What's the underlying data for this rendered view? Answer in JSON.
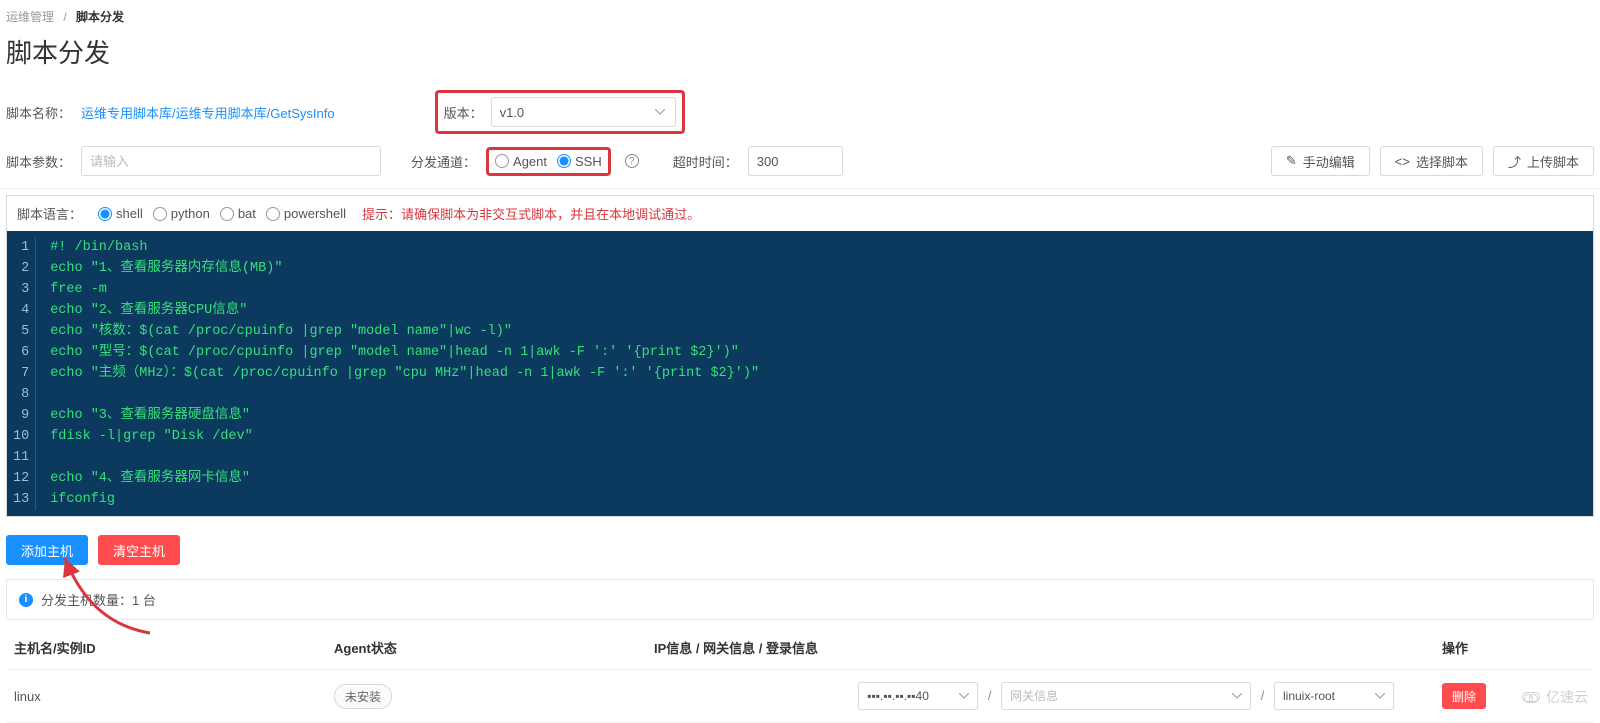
{
  "breadcrumb": {
    "parent": "运维管理",
    "current": "脚本分发"
  },
  "page_title": "脚本分发",
  "form": {
    "script_name_label": "脚本名称：",
    "script_name_value": "运维专用脚本库/运维专用脚本库/GetSysInfo",
    "version_label": "版本：",
    "version_value": "v1.0",
    "params_label": "脚本参数：",
    "params_placeholder": "请输入",
    "channel_label": "分发通道：",
    "channel_options": {
      "agent": "Agent",
      "ssh": "SSH"
    },
    "channel_selected": "ssh",
    "timeout_label": "超时时间：",
    "timeout_value": "300"
  },
  "toolbar": {
    "manual_edit": "手动编辑",
    "choose_script": "选择脚本",
    "upload_script": "上传脚本"
  },
  "editor": {
    "lang_label": "脚本语言：",
    "langs": {
      "shell": "shell",
      "python": "python",
      "bat": "bat",
      "powershell": "powershell"
    },
    "lang_selected": "shell",
    "hint_label": "提示：",
    "hint_text": "请确保脚本为非交互式脚本，并且在本地调试通过。",
    "lines": [
      "#! /bin/bash",
      "echo \"1、查看服务器内存信息(MB)\"",
      "free -m",
      "echo \"2、查看服务器CPU信息\"",
      "echo \"核数：$(cat /proc/cpuinfo |grep \"model name\"|wc -l)\"",
      "echo \"型号：$(cat /proc/cpuinfo |grep \"model name\"|head -n 1|awk -F ':' '{print $2}')\"",
      "echo \"主频（MHz）：$(cat /proc/cpuinfo |grep \"cpu MHz\"|head -n 1|awk -F ':' '{print $2}')\"",
      "",
      "echo \"3、查看服务器硬盘信息\"",
      "fdisk -l|grep \"Disk /dev\"",
      "",
      "echo \"4、查看服务器网卡信息\"",
      "ifconfig"
    ]
  },
  "host_actions": {
    "add": "添加主机",
    "clear": "清空主机"
  },
  "info_bar": "分发主机数量：1 台",
  "table": {
    "headers": {
      "host": "主机名/实例ID",
      "agent": "Agent状态",
      "ip": "IP信息 / 网关信息 / 登录信息",
      "op": "操作"
    },
    "row": {
      "host": "linux",
      "agent_status": "未安装",
      "ip_value": "▪▪▪.▪▪.▪▪.▪▪40",
      "gateway_placeholder": "网关信息",
      "login_value": "linuix-root",
      "delete": "删除"
    }
  },
  "watermark": "亿速云"
}
